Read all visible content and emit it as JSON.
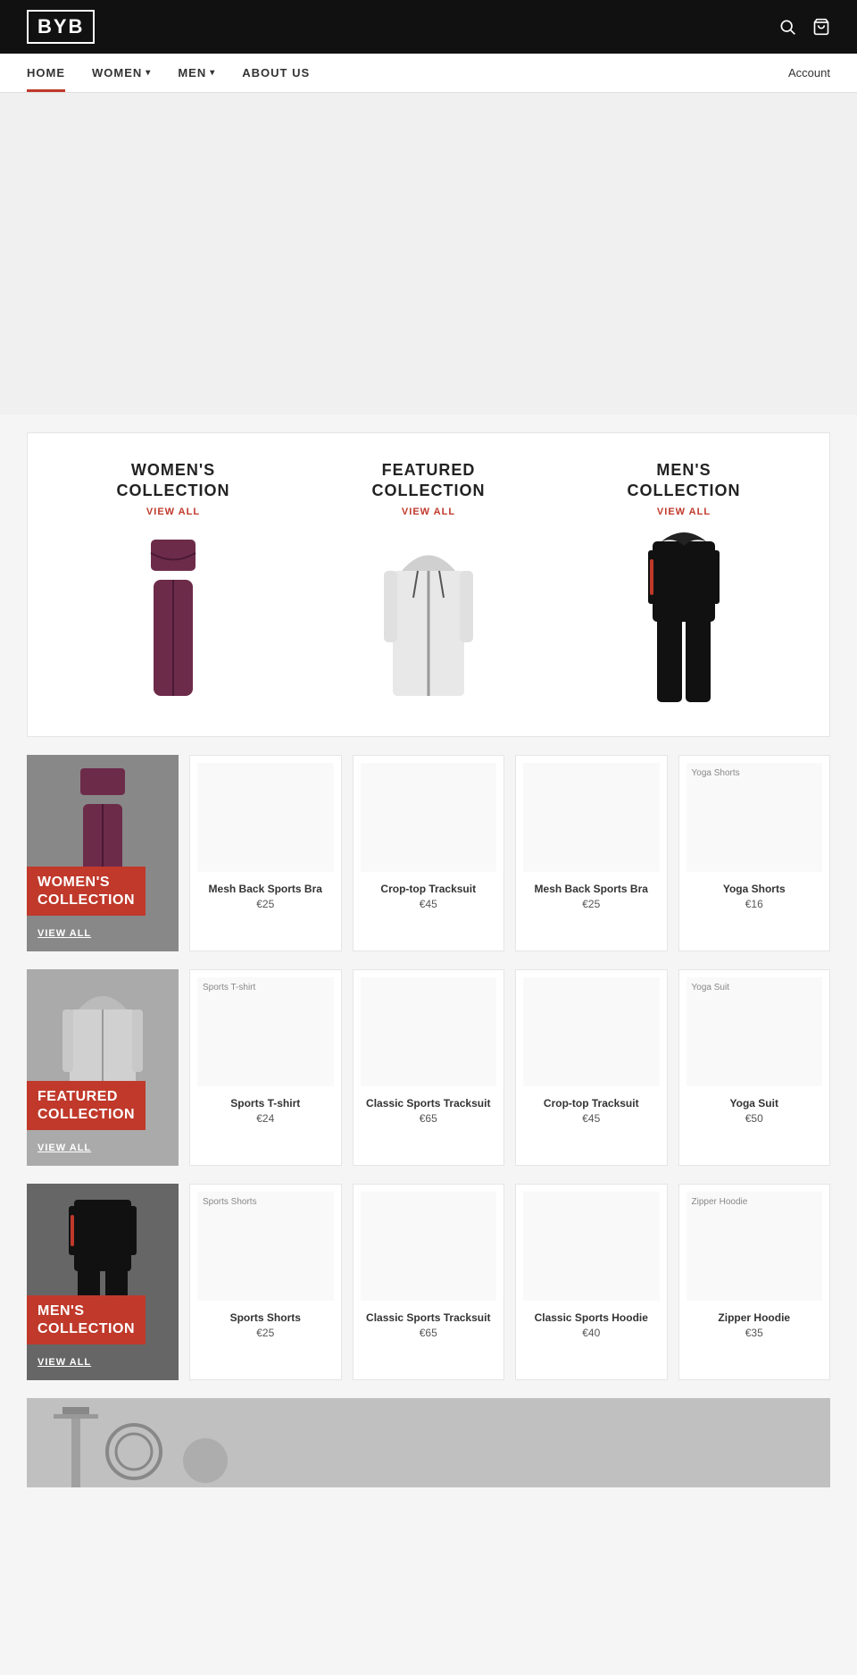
{
  "header": {
    "logo": "BYB",
    "search_icon": "🔍",
    "cart_icon": "🛒"
  },
  "nav": {
    "items": [
      {
        "label": "HOME",
        "active": true
      },
      {
        "label": "WOMEN",
        "hasArrow": true
      },
      {
        "label": "MEN",
        "hasArrow": true
      },
      {
        "label": "ABOUT US",
        "hasArrow": false
      }
    ],
    "account": "Account"
  },
  "collections_banner": {
    "items": [
      {
        "title": "WOMEN'S\nCOLLECTION",
        "view_all": "VIEW ALL",
        "type": "women"
      },
      {
        "title": "FEATURED\nCOLLECTION",
        "view_all": "VIEW ALL",
        "type": "featured"
      },
      {
        "title": "MEN'S\nCOLLECTION",
        "view_all": "VIEW ALL",
        "type": "men"
      }
    ]
  },
  "sections": [
    {
      "id": "women",
      "card_label": "WOMEN'S\nCOLLECTION",
      "card_view_all": "VIEW ALL",
      "card_type": "women",
      "products": [
        {
          "name": "Mesh Back Sports Bra",
          "price": "€25",
          "label": ""
        },
        {
          "name": "Crop-top Tracksuit",
          "price": "€45",
          "label": ""
        },
        {
          "name": "Mesh Back Sports Bra",
          "price": "€25",
          "label": ""
        },
        {
          "name": "Yoga Shorts",
          "price": "€16",
          "label": "Yoga Shorts"
        }
      ]
    },
    {
      "id": "featured",
      "card_label": "FEATURED\nCOLLECTION",
      "card_view_all": "VIEW ALL",
      "card_type": "featured",
      "products": [
        {
          "name": "Sports T-shirt",
          "price": "€24",
          "label": "Sports T-shirt"
        },
        {
          "name": "Classic Sports Tracksuit",
          "price": "€65",
          "label": ""
        },
        {
          "name": "Crop-top Tracksuit",
          "price": "€45",
          "label": ""
        },
        {
          "name": "Yoga Suit",
          "price": "€50",
          "label": "Yoga Suit"
        }
      ]
    },
    {
      "id": "men",
      "card_label": "MEN'S\nCOLLECTION",
      "card_view_all": "VIEW ALL",
      "card_type": "men",
      "products": [
        {
          "name": "Sports Shorts",
          "price": "€25",
          "label": "Sports Shorts"
        },
        {
          "name": "Classic Sports Tracksuit",
          "price": "€65",
          "label": ""
        },
        {
          "name": "Classic Sports Hoodie",
          "price": "€40",
          "label": ""
        },
        {
          "name": "Zipper Hoodie",
          "price": "€35",
          "label": "Zipper Hoodie"
        }
      ]
    }
  ]
}
